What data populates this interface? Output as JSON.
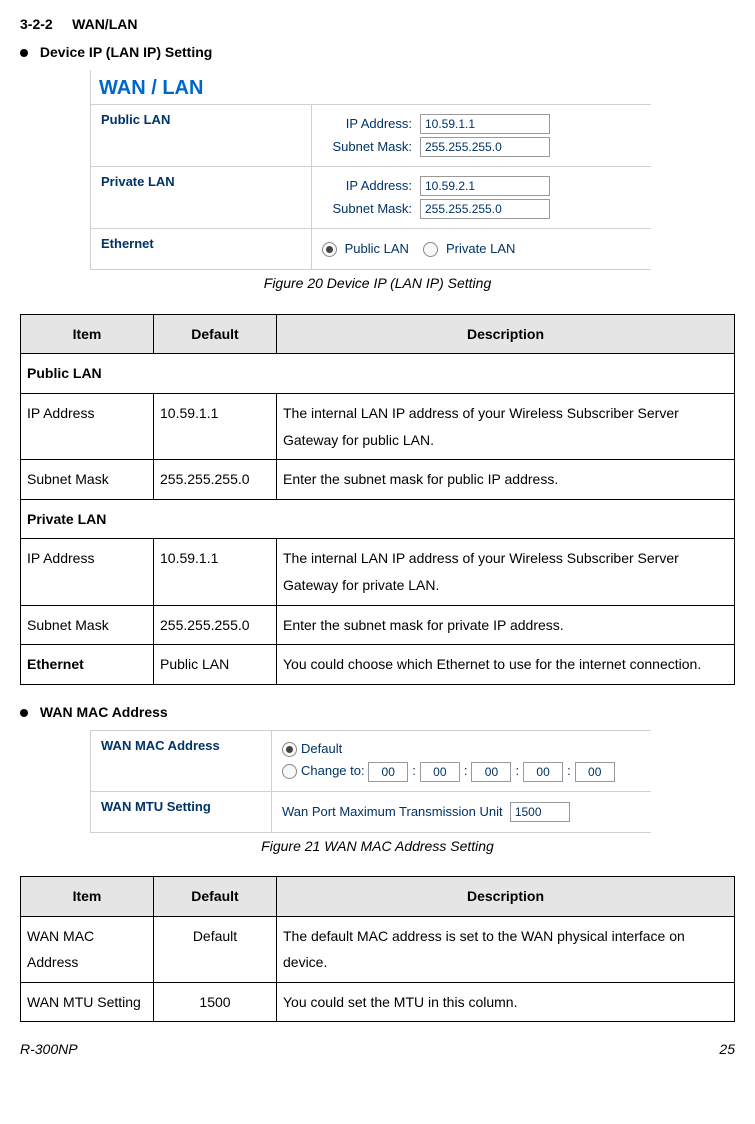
{
  "header": {
    "section": "3-2-2",
    "title": "WAN/LAN"
  },
  "bullet1": "Device IP (LAN IP) Setting",
  "figure1": {
    "title": "WAN / LAN",
    "sections": {
      "publicLan": {
        "label": "Public LAN",
        "ipLabel": "IP Address:",
        "ip": "10.59.1.1",
        "maskLabel": "Subnet Mask:",
        "mask": "255.255.255.0"
      },
      "privateLan": {
        "label": "Private LAN",
        "ipLabel": "IP Address:",
        "ip": "10.59.2.1",
        "maskLabel": "Subnet Mask:",
        "mask": "255.255.255.0"
      },
      "ethernet": {
        "label": "Ethernet",
        "opt1": "Public LAN",
        "opt2": "Private LAN"
      }
    },
    "caption": "Figure 20 Device IP (LAN IP) Setting"
  },
  "table1": {
    "head": {
      "item": "Item",
      "def": "Default",
      "desc": "Description"
    },
    "rows": {
      "r0": {
        "span": "Public LAN"
      },
      "r1": {
        "item": "IP Address",
        "def": "10.59.1.1",
        "desc": "The internal LAN IP address of your Wireless Subscriber Server Gateway for public LAN."
      },
      "r2": {
        "item": "Subnet Mask",
        "def": "255.255.255.0",
        "desc": "Enter the subnet mask for public IP address."
      },
      "r3": {
        "span": "Private LAN"
      },
      "r4": {
        "item": "IP Address",
        "def": "10.59.1.1",
        "desc": "The internal LAN IP address of your Wireless Subscriber Server Gateway for private LAN."
      },
      "r5": {
        "item": "Subnet Mask",
        "def": "255.255.255.0",
        "desc": "Enter the subnet mask for private IP address."
      },
      "r6": {
        "item": "Ethernet",
        "def": "Public LAN",
        "desc": "You could choose which Ethernet to use for the internet connection."
      }
    }
  },
  "bullet2": "WAN MAC Address",
  "figure2": {
    "rows": {
      "r0": {
        "label": "WAN MAC Address",
        "optDefault": "Default",
        "optChange": "Change to:",
        "m0": "00",
        "m1": "00",
        "m2": "00",
        "m3": "00",
        "m4": "00"
      },
      "r1": {
        "label": "WAN MTU Setting",
        "text": "Wan Port Maximum Transmission Unit",
        "val": "1500"
      }
    },
    "caption": "Figure 21 WAN MAC Address Setting"
  },
  "table2": {
    "head": {
      "item": "Item",
      "def": "Default",
      "desc": "Description"
    },
    "rows": {
      "r0": {
        "item": "WAN MAC Address",
        "def": "Default",
        "desc": "The default MAC address is set to the WAN physical interface on device."
      },
      "r1": {
        "item": "WAN MTU Setting",
        "def": "1500",
        "desc": "You could set the MTU in this column."
      }
    }
  },
  "footer": {
    "left": "R-300NP",
    "right": "25"
  }
}
